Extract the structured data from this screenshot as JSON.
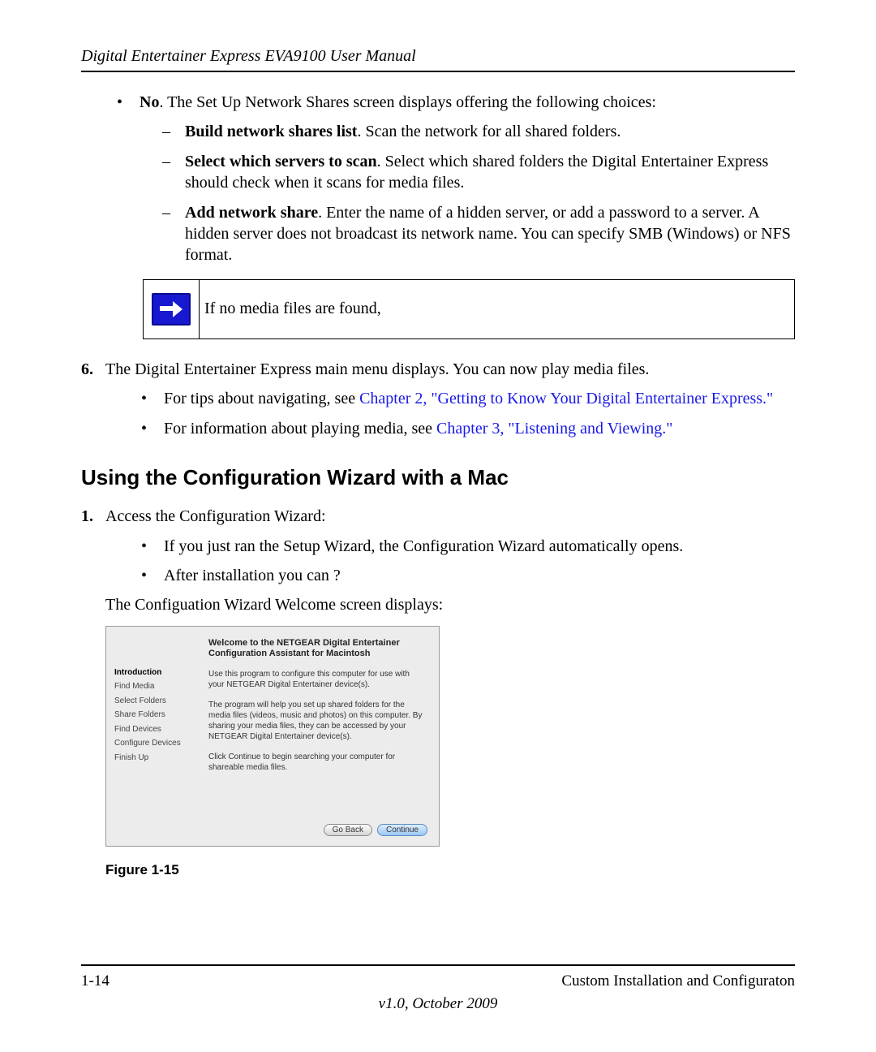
{
  "header": {
    "running_title": "Digital Entertainer Express EVA9100 User Manual"
  },
  "body": {
    "no_bullet": {
      "label": "No",
      "text": ". The Set Up Network Shares screen displays offering the following choices:"
    },
    "sub_items": [
      {
        "label": "Build network shares list",
        "text": ". Scan the network for all shared folders."
      },
      {
        "label": "Select which servers to scan",
        "text": ". Select which shared folders the Digital Entertainer Express should check when it scans for media files."
      },
      {
        "label": "Add network share",
        "text": ". Enter the name of a hidden server, or add a password to a server. A hidden server does not broadcast its network name. You can specify SMB (Windows) or NFS format."
      }
    ],
    "note_text": "If no media files are found,",
    "step6": {
      "num": "6.",
      "text": "The Digital Entertainer Express main menu displays. You can now play media files."
    },
    "step6_sub": [
      {
        "pre": "For tips about navigating, see ",
        "link": "Chapter 2, \"Getting to Know Your Digital Entertainer Express.\""
      },
      {
        "pre": "For information about playing media, see ",
        "link": "Chapter 3, \"Listening and Viewing.\""
      }
    ],
    "section_heading": "Using the Configuration Wizard with a Mac",
    "step1": {
      "num": "1.",
      "text": "Access the Configuration Wizard:"
    },
    "step1_sub": [
      "If you just ran the Setup Wizard, the Configuration Wizard automatically opens.",
      "After installation you can ?"
    ],
    "welcome_line": "The Configuation Wizard Welcome screen displays:",
    "wizard": {
      "title": "Welcome to the NETGEAR Digital Entertainer Configuration Assistant for Macintosh",
      "sidebar": [
        "Introduction",
        "Find Media",
        "Select Folders",
        "Share Folders",
        "Find Devices",
        "Configure Devices",
        "Finish Up"
      ],
      "para1": "Use this program to configure this computer for use with your NETGEAR Digital Entertainer device(s).",
      "para2": "The program will help you set up shared folders for the media files (videos, music and photos) on this computer. By sharing your media files, they can be accessed by your NETGEAR Digital Entertainer device(s).",
      "para3": "Click Continue to begin searching your computer for shareable media files.",
      "go_back": "Go Back",
      "continue": "Continue"
    },
    "figure_caption": "Figure 1-15"
  },
  "footer": {
    "page_num": "1-14",
    "section": "Custom Installation and Configuraton",
    "version": "v1.0, October 2009"
  }
}
